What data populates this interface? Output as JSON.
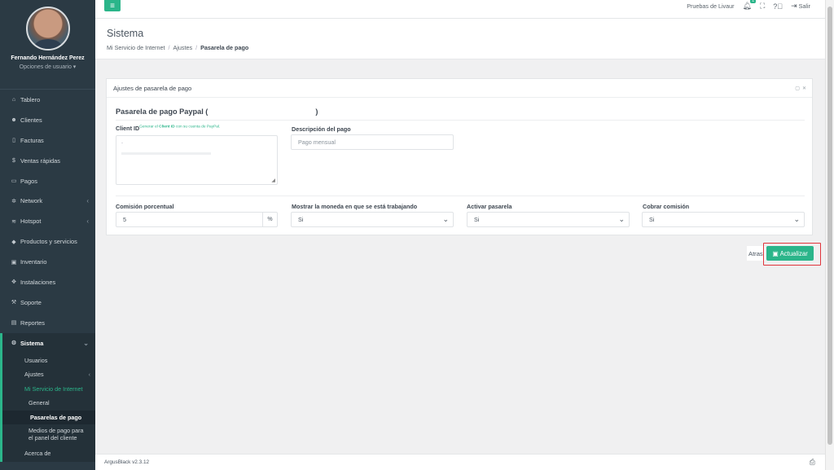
{
  "user": {
    "name": "Fernando Hernández Perez",
    "options_label": "Opciones de usuario ▾"
  },
  "sidebar": {
    "items": [
      {
        "label": "Tablero",
        "icon": "dashboard-icon"
      },
      {
        "label": "Clientes",
        "icon": "users-icon"
      },
      {
        "label": "Facturas",
        "icon": "file-icon"
      },
      {
        "label": "Ventas rápidas",
        "icon": "dollar-icon"
      },
      {
        "label": "Pagos",
        "icon": "money-icon"
      },
      {
        "label": "Network",
        "icon": "network-icon"
      },
      {
        "label": "Hotspot",
        "icon": "wifi-icon"
      },
      {
        "label": "Productos y servicios",
        "icon": "tag-icon"
      },
      {
        "label": "Inventario",
        "icon": "cubes-icon"
      },
      {
        "label": "Instalaciones",
        "icon": "tools-icon"
      },
      {
        "label": "Soporte",
        "icon": "wrench-icon"
      },
      {
        "label": "Reportes",
        "icon": "report-icon"
      },
      {
        "label": "Sistema",
        "icon": "cogs-icon"
      }
    ],
    "sistema_sub": {
      "usuarios": "Usuarios",
      "ajustes": "Ajustes",
      "mi_servicio": "Mi Servicio de Internet",
      "general": "General",
      "pasarelas": "Pasarelas de pago",
      "medios_l1": "Medios de pago para",
      "medios_l2": "el panel del cliente",
      "acerca": "Acerca de"
    }
  },
  "topbar": {
    "company": "Pruebas de Livaur",
    "notification_count": "1",
    "logout": "Salir"
  },
  "header": {
    "title": "Sistema",
    "breadcrumb": [
      "Mi Servicio de Internet",
      "Ajustes",
      "Pasarela de pago"
    ]
  },
  "panel": {
    "title": "Ajustes de pasarela de pago",
    "section_title_start": "Pasarela de pago Paypal (",
    "section_title_end": ")",
    "client_id_label": "Client ID",
    "client_id_hint_pre": "Generar el ",
    "client_id_hint_bold": "Client ID",
    "client_id_hint_post": " con su cuenta de PayPal.",
    "client_id_value": "-",
    "descripcion_label": "Descripción del pago",
    "descripcion_placeholder": "Pago mensual",
    "comision_label": "Comisión porcentual",
    "comision_value": "5",
    "comision_unit": "%",
    "moneda_label": "Mostrar la moneda en que se está trabajando",
    "moneda_value": "Si",
    "activar_label": "Activar pasarela",
    "activar_value": "Si",
    "cobrar_label": "Cobrar comisión",
    "cobrar_value": "Si"
  },
  "actions": {
    "back_label": "Atras",
    "update_label": "Actualizar"
  },
  "footer": {
    "version": "ArgusBlack v2.3.12"
  },
  "colors": {
    "accent": "#2bb58a",
    "sidebar_bg": "#2b3a44",
    "highlight": "#e0343b"
  }
}
